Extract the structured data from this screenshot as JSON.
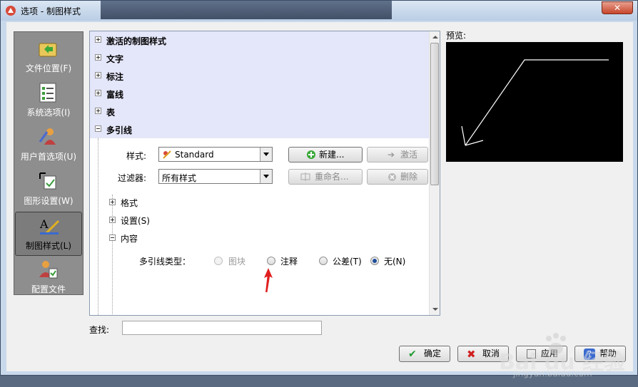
{
  "window": {
    "title": "选项 - 制图样式",
    "close_symbol": "✕"
  },
  "sidebar": {
    "items": [
      {
        "label": "文件位置(F)",
        "icon": "folder-arrow-icon"
      },
      {
        "label": "系统选项(I)",
        "icon": "checklist-icon"
      },
      {
        "label": "用户首选项(U)",
        "icon": "user-preferences-icon"
      },
      {
        "label": "图形设置(W)",
        "icon": "graphics-settings-icon"
      },
      {
        "label": "制图样式(L)",
        "icon": "drafting-style-icon",
        "selected": true
      },
      {
        "label": "配置文件",
        "icon": "profile-icon"
      }
    ]
  },
  "tree": {
    "sections": [
      {
        "label": "激活的制图样式",
        "expanded": false
      },
      {
        "label": "文字",
        "expanded": false
      },
      {
        "label": "标注",
        "expanded": false
      },
      {
        "label": "富线",
        "expanded": false
      },
      {
        "label": "表",
        "expanded": false
      },
      {
        "label": "多引线",
        "expanded": true
      }
    ],
    "style_label": "样式:",
    "style_value": "Standard",
    "filter_label": "过滤器:",
    "filter_value": "所有样式",
    "buttons": {
      "new": "新建...",
      "activate": "激活",
      "rename": "重命名...",
      "delete": "删除"
    },
    "subsections": [
      {
        "label": "格式",
        "expanded": false
      },
      {
        "label": "设置(S)",
        "expanded": false
      },
      {
        "label": "内容",
        "expanded": true
      }
    ],
    "leader_type": {
      "label": "多引线类型：",
      "options": [
        {
          "label": "图块",
          "state": "disabled"
        },
        {
          "label": "注释",
          "state": "off"
        },
        {
          "label": "公差(T)",
          "state": "off"
        },
        {
          "label": "无(N)",
          "state": "on"
        }
      ]
    }
  },
  "preview": {
    "label": "预览:"
  },
  "search": {
    "label": "查找:",
    "value": ""
  },
  "footer": {
    "ok": "确定",
    "cancel": "取消",
    "apply": "应用",
    "help": "帮助"
  },
  "watermark": {
    "text": "Bai du 经验",
    "sub": "jingyan.baidu.com"
  },
  "colors": {
    "tree_header_bg": "#e4e6f9",
    "sidebar_bg": "#8e8e8e",
    "preview_bg": "#000000",
    "annotation_arrow": "#e02020"
  }
}
